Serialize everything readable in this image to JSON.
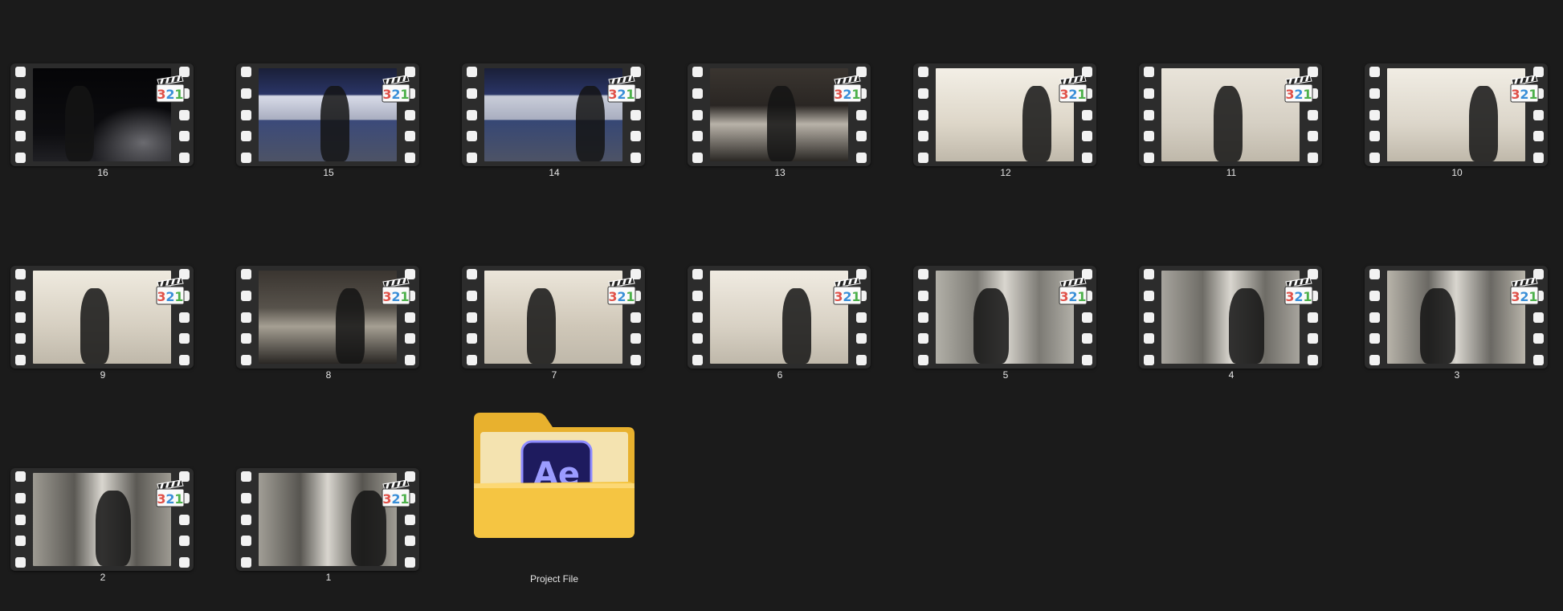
{
  "items": [
    {
      "label": "16",
      "row": 0,
      "col": 0,
      "scene": "night",
      "tone": "#0d0d10",
      "accent": "#3a3a42"
    },
    {
      "label": "15",
      "row": 0,
      "col": 1,
      "scene": "gasstation",
      "tone": "#3b4a7a",
      "accent": "#d8dbe8"
    },
    {
      "label": "14",
      "row": 0,
      "col": 2,
      "scene": "gasstation",
      "tone": "#364775",
      "accent": "#c9cdd9"
    },
    {
      "label": "13",
      "row": 0,
      "col": 3,
      "scene": "garage-dark",
      "tone": "#2a2623",
      "accent": "#b8b2a8"
    },
    {
      "label": "12",
      "row": 0,
      "col": 4,
      "scene": "garage-bright",
      "tone": "#ddd6c8",
      "accent": "#f3efe6"
    },
    {
      "label": "11",
      "row": 0,
      "col": 5,
      "scene": "garage-bright",
      "tone": "#d5cfc3",
      "accent": "#e9e4da"
    },
    {
      "label": "10",
      "row": 0,
      "col": 6,
      "scene": "garage-bright",
      "tone": "#dcd6ca",
      "accent": "#f1ede4"
    },
    {
      "label": "9",
      "row": 1,
      "col": 0,
      "scene": "garage-bright",
      "tone": "#d6cfc1",
      "accent": "#efeadf"
    },
    {
      "label": "8",
      "row": 1,
      "col": 1,
      "scene": "garage-dark",
      "tone": "#57524b",
      "accent": "#a59f93"
    },
    {
      "label": "7",
      "row": 1,
      "col": 2,
      "scene": "garage-bright",
      "tone": "#cfc7b8",
      "accent": "#ece6da"
    },
    {
      "label": "6",
      "row": 1,
      "col": 3,
      "scene": "garage-bright",
      "tone": "#d8d1c4",
      "accent": "#f0ebe1"
    },
    {
      "label": "5",
      "row": 1,
      "col": 4,
      "scene": "kitchen",
      "tone": "#7c7a74",
      "accent": "#b2b0a8"
    },
    {
      "label": "4",
      "row": 1,
      "col": 5,
      "scene": "kitchen",
      "tone": "#6e6c66",
      "accent": "#a7a49d"
    },
    {
      "label": "3",
      "row": 1,
      "col": 6,
      "scene": "kitchen",
      "tone": "#6a6863",
      "accent": "#b8b4aa"
    },
    {
      "label": "2",
      "row": 2,
      "col": 0,
      "scene": "kitchen",
      "tone": "#5b5954",
      "accent": "#9d9a92"
    },
    {
      "label": "1",
      "row": 2,
      "col": 1,
      "scene": "kitchen",
      "tone": "#575550",
      "accent": "#a19e96"
    }
  ],
  "folder": {
    "label": "Project File",
    "badge_text": "Ae",
    "folder_color": "#f5c542",
    "folder_back_color": "#e8b12e",
    "ae_bg": "#1e1b5e",
    "ae_text": "#9b9cff"
  },
  "player_badge": {
    "text": "321",
    "digit_colors": [
      "#e0524a",
      "#3a8fd8",
      "#4cb04a"
    ]
  }
}
